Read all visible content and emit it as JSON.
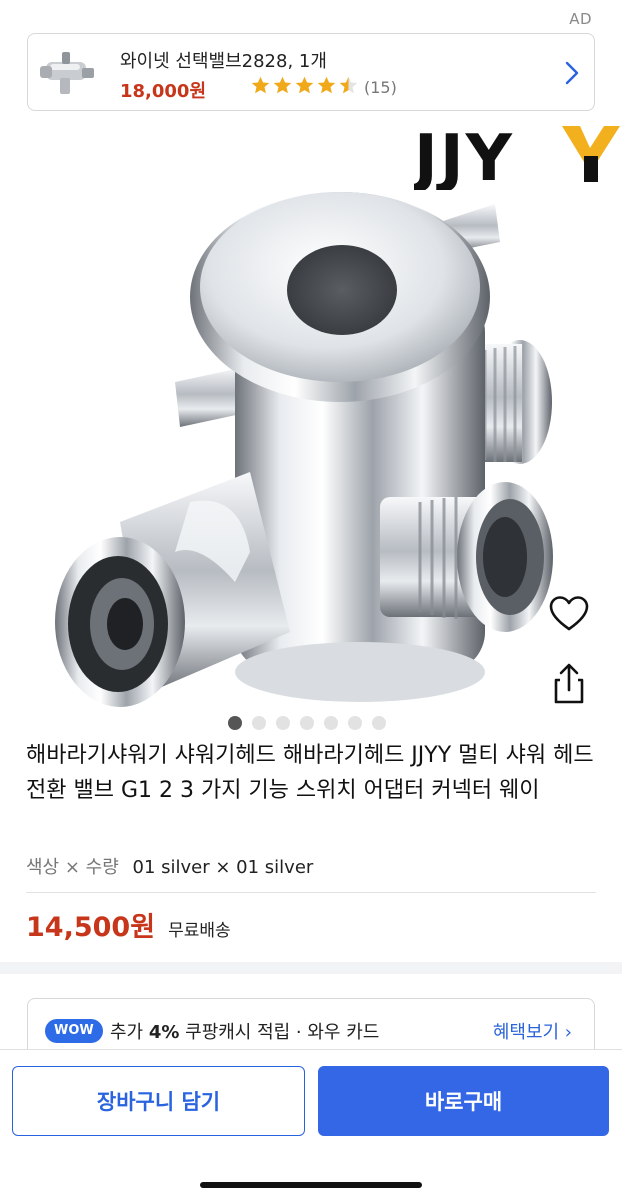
{
  "ad": {
    "label": "AD",
    "title": "와이넷 선택밸브2828, 1개",
    "price": "18,000원",
    "rating": 4.5,
    "review_count": "(15)",
    "star_color": "#f0a91a"
  },
  "product": {
    "brand_logo": "JJYY",
    "image_count": 7,
    "active_image": 1,
    "title": "해바라기샤워기 샤워기헤드 해바라기헤드 JJYY 멀티 샤워 헤드 전환 밸브 G1 2 3 가지 기능 스위치 어댑터 커넥터 웨이",
    "option_label": "색상 × 수량",
    "option_value": "01 silver × 01 silver",
    "price": "14,500원",
    "shipping": "무료배송"
  },
  "benefit": {
    "badge": "WOW",
    "text_prefix": "추가 ",
    "text_percent": "4%",
    "text_suffix": " 쿠팡캐시 적립 · 와우 카드",
    "link": "혜택보기 ›"
  },
  "actions": {
    "cart": "장바구니 담기",
    "buy": "바로구매"
  },
  "colors": {
    "price_red": "#c7361a",
    "primary_blue": "#3367e6",
    "logo_yellow": "#f2b01e"
  }
}
